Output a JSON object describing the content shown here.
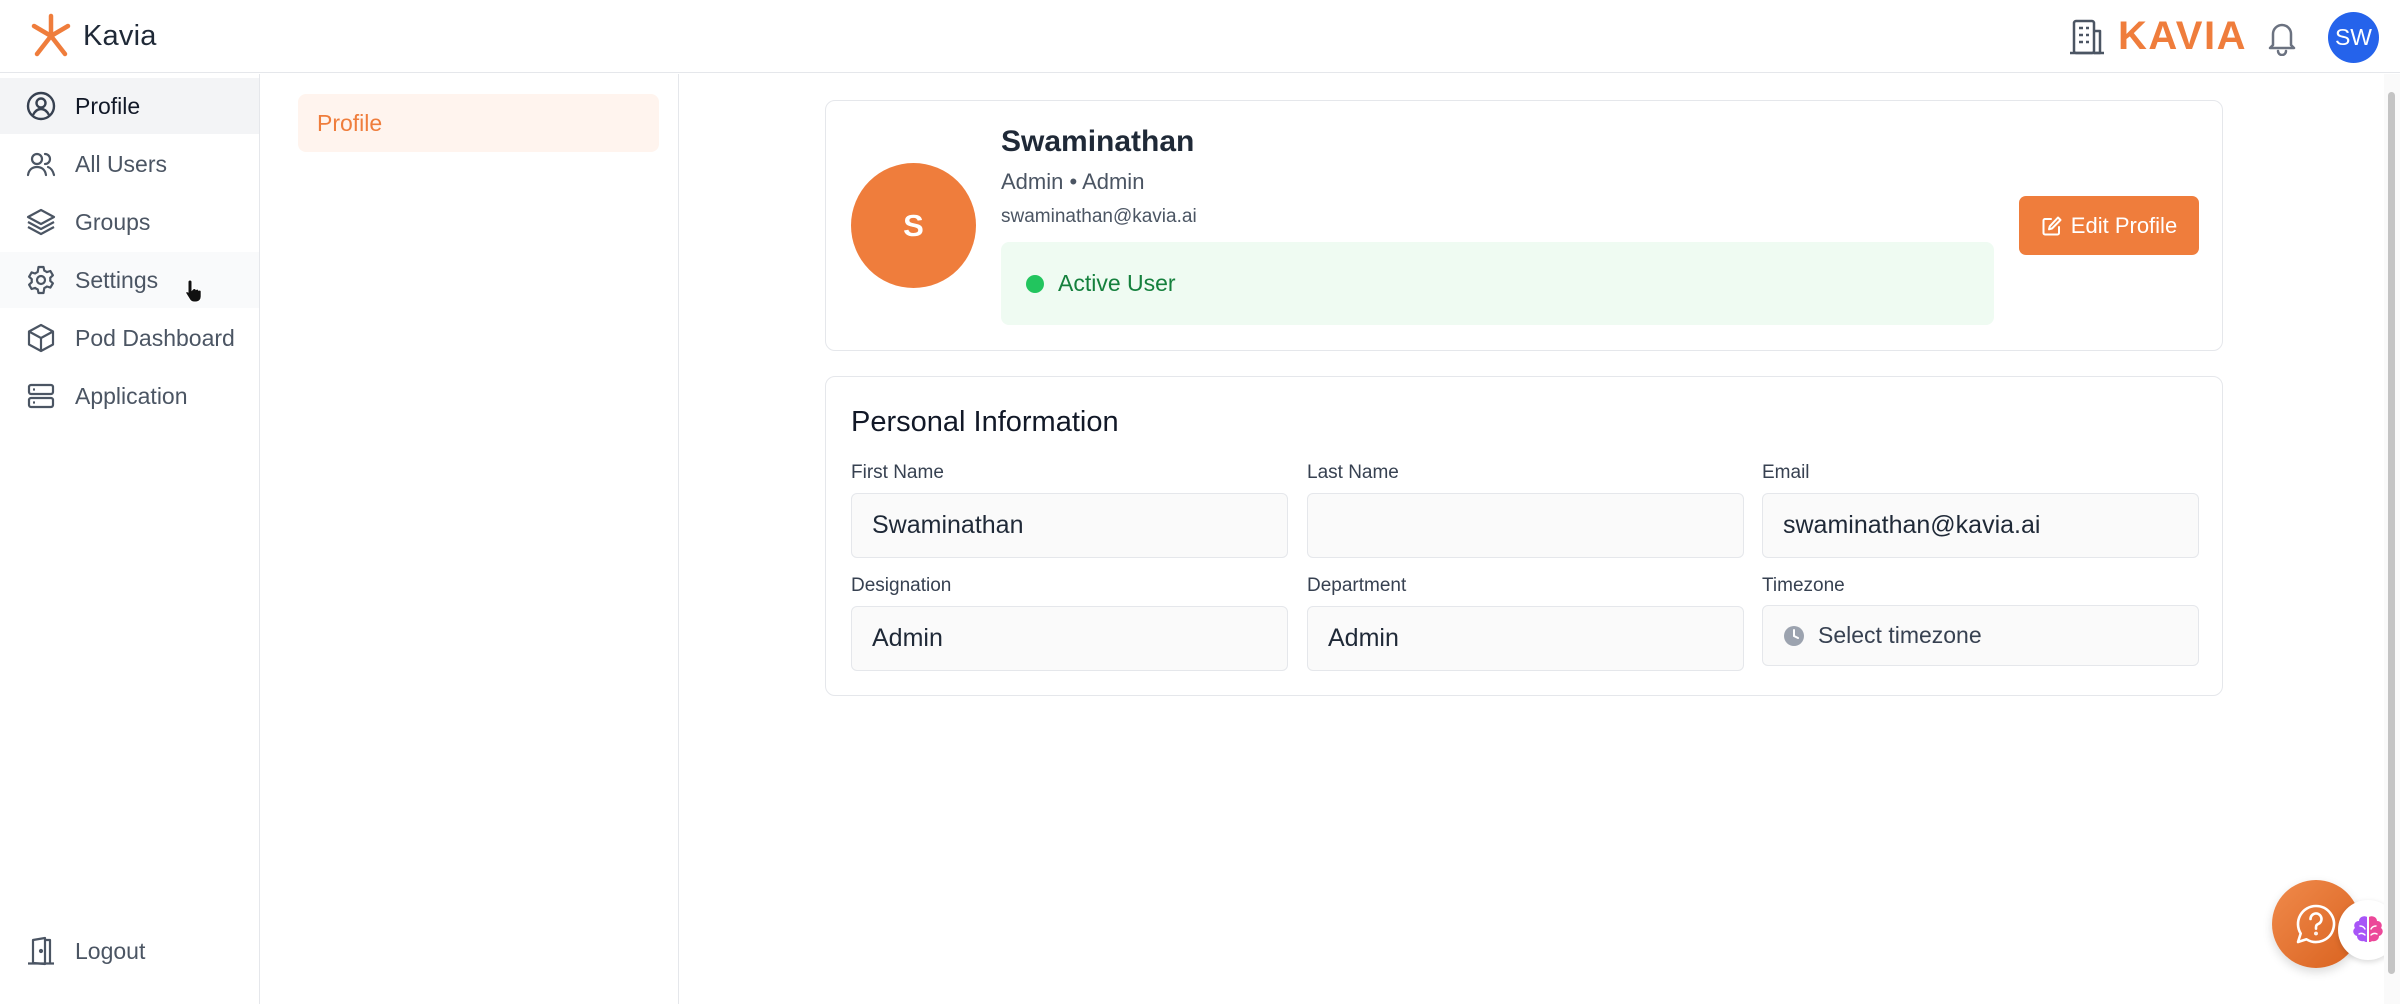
{
  "header": {
    "brand_name": "Kavia",
    "org_name": "KAVIA",
    "avatar_initials": "SW",
    "accent_color": "#ef7d3c",
    "avatar_color": "#2563eb"
  },
  "sidebar": {
    "items": [
      {
        "label": "Profile",
        "icon": "user-circle-icon",
        "active": true
      },
      {
        "label": "All Users",
        "icon": "users-icon"
      },
      {
        "label": "Groups",
        "icon": "layers-icon"
      },
      {
        "label": "Settings",
        "icon": "gear-icon"
      },
      {
        "label": "Pod Dashboard",
        "icon": "cube-icon"
      },
      {
        "label": "Application",
        "icon": "server-icon"
      }
    ],
    "logout_label": "Logout"
  },
  "subnav": {
    "tabs": [
      {
        "label": "Profile",
        "active": true
      }
    ]
  },
  "profile": {
    "avatar_letter": "S",
    "name": "Swaminathan",
    "role_line": "Admin • Admin",
    "email": "swaminathan@kavia.ai",
    "status": "Active User",
    "edit_button": "Edit Profile"
  },
  "personal_info": {
    "title": "Personal Information",
    "fields": {
      "first_name": {
        "label": "First Name",
        "value": "Swaminathan"
      },
      "last_name": {
        "label": "Last Name",
        "value": ""
      },
      "email": {
        "label": "Email",
        "value": "swaminathan@kavia.ai"
      },
      "designation": {
        "label": "Designation",
        "value": "Admin"
      },
      "department": {
        "label": "Department",
        "value": "Admin"
      },
      "timezone": {
        "label": "Timezone",
        "placeholder": "Select timezone"
      }
    }
  }
}
